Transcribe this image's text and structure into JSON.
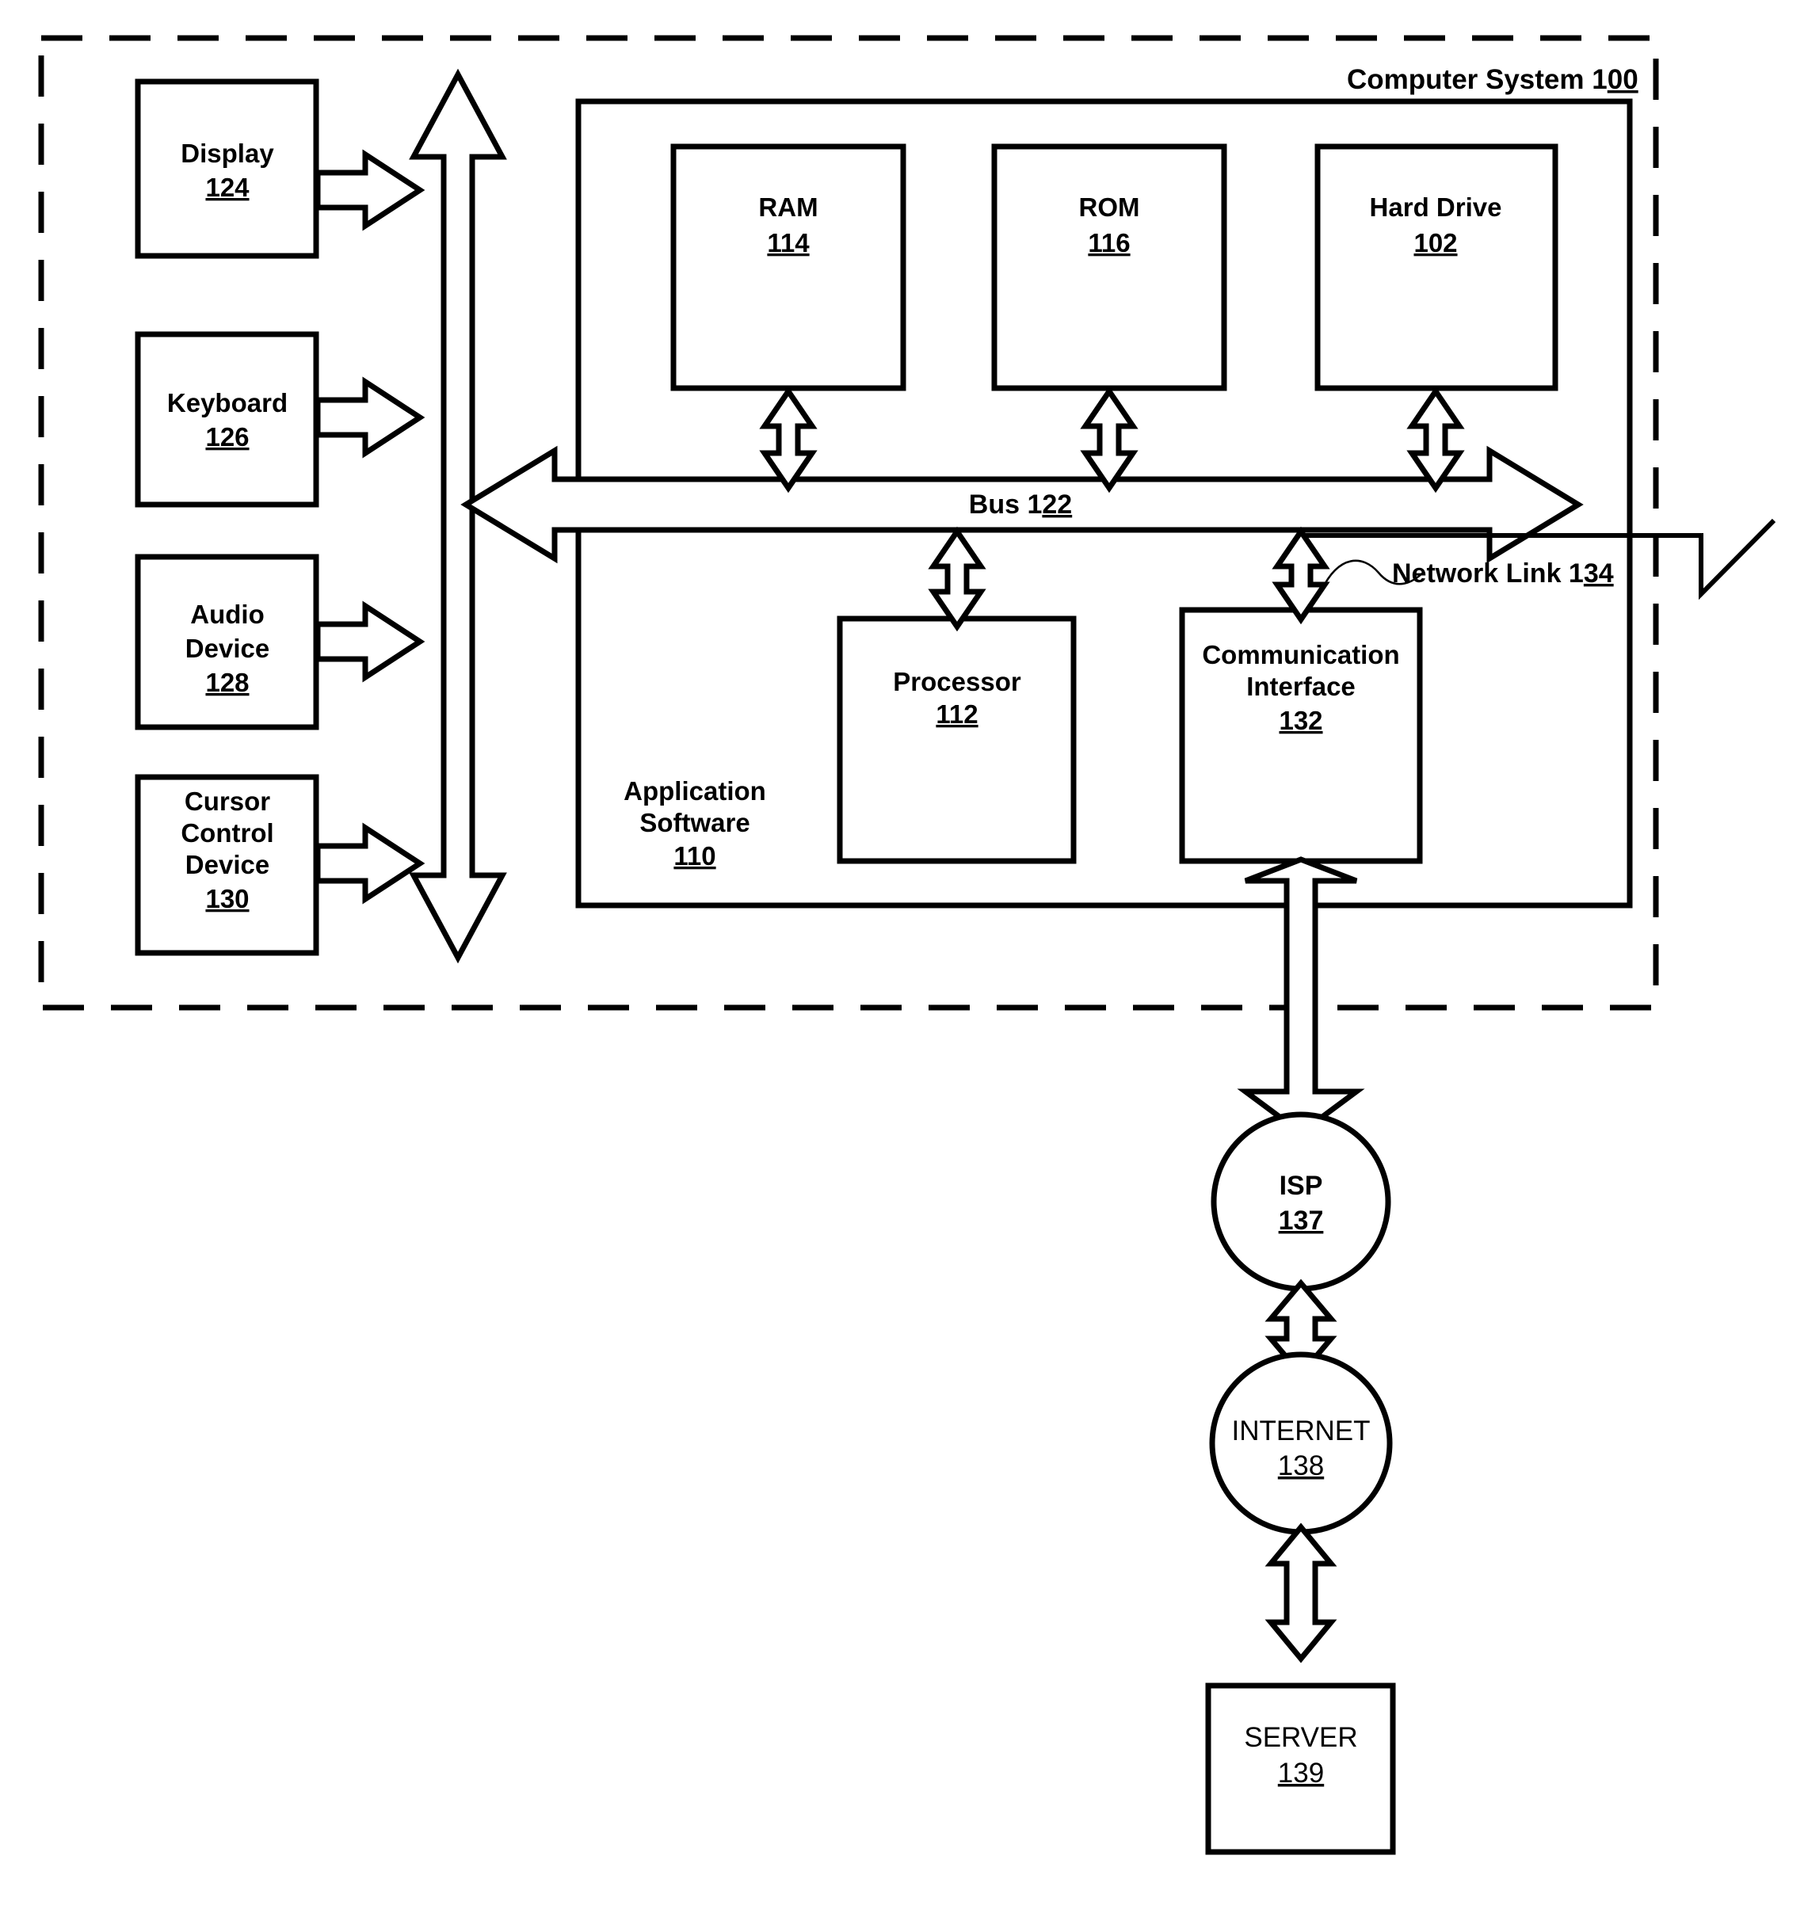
{
  "figure": {
    "title_label": "Computer System",
    "title_ref_prefix": "1",
    "title_ref_underlined": "00"
  },
  "peripherals": [
    {
      "name": "display",
      "lines": [
        "Display"
      ],
      "ref": "124"
    },
    {
      "name": "keyboard",
      "lines": [
        "Keyboard"
      ],
      "ref": "126"
    },
    {
      "name": "audio-device",
      "lines": [
        "Audio",
        "Device"
      ],
      "ref": "128"
    },
    {
      "name": "cursor-control",
      "lines": [
        "Cursor",
        "Control",
        "Device"
      ],
      "ref": "130"
    }
  ],
  "memory_blocks": [
    {
      "name": "ram",
      "label": "RAM",
      "ref": "114"
    },
    {
      "name": "rom",
      "label": "ROM",
      "ref": "116"
    },
    {
      "name": "hard-drive",
      "label": "Hard Drive",
      "ref": "102"
    }
  ],
  "core_blocks": [
    {
      "name": "processor",
      "lines": [
        "Processor"
      ],
      "ref": "112"
    },
    {
      "name": "communication-interface",
      "lines": [
        "Communication",
        "Interface"
      ],
      "ref": "132"
    }
  ],
  "bus": {
    "label": "Bus 1",
    "ref_underlined": "22"
  },
  "network_link": {
    "label": "Network Link 1",
    "ref_underlined": "34"
  },
  "application_software": {
    "lines": [
      "Application",
      "Software"
    ],
    "ref": "110"
  },
  "network_nodes": [
    {
      "name": "isp",
      "shape": "circle",
      "label": "ISP",
      "ref": "137"
    },
    {
      "name": "internet",
      "shape": "circle",
      "label": "INTERNET",
      "ref": "138"
    },
    {
      "name": "server",
      "shape": "rect",
      "label": "SERVER",
      "ref": "139"
    }
  ],
  "colors": {
    "line": "#000000",
    "fill": "#ffffff",
    "background": "#ffffff"
  }
}
